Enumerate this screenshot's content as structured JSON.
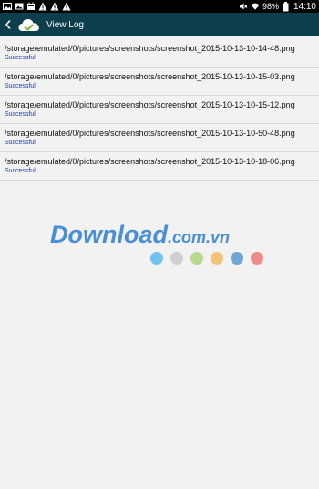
{
  "status_bar": {
    "battery_percent": "98%",
    "time": "14:10"
  },
  "app_bar": {
    "title": "View Log"
  },
  "log": {
    "entries": [
      {
        "path": "/storage/emulated/0/pictures/screenshots/screenshot_2015-10-13-10-14-48.png",
        "status": "Successful"
      },
      {
        "path": "/storage/emulated/0/pictures/screenshots/screenshot_2015-10-13-10-15-03.png",
        "status": "Successful"
      },
      {
        "path": "/storage/emulated/0/pictures/screenshots/screenshot_2015-10-13-10-15-12.png",
        "status": "Successful"
      },
      {
        "path": "/storage/emulated/0/pictures/screenshots/screenshot_2015-10-13-10-50-48.png",
        "status": "Successful"
      },
      {
        "path": "/storage/emulated/0/pictures/screenshots/screenshot_2015-10-13-10-18-06.png",
        "status": "Successful"
      }
    ]
  },
  "watermark": {
    "main": "Download",
    "suffix": ".com.vn",
    "dot_colors": [
      "#6ec3f0",
      "#cfcfcf",
      "#b6d98a",
      "#f3c27a",
      "#6ea6d6",
      "#f08a8a"
    ]
  }
}
